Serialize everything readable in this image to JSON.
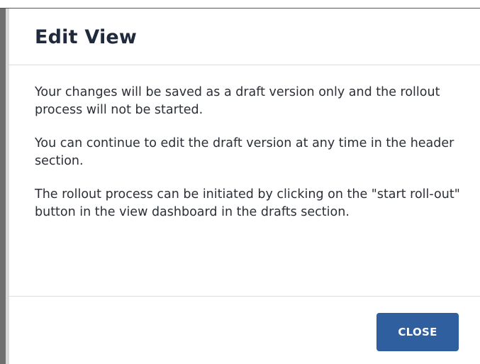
{
  "dialog": {
    "title": "Edit View",
    "paragraphs": [
      "Your changes will be saved as a draft version only and the rollout process will not be started.",
      "You can continue to edit the draft version at any time in the header section.",
      "The rollout process can be initiated by clicking on the \"start roll-out\" button in the view dashboard in the drafts section."
    ],
    "close_label": "CLOSE"
  },
  "colors": {
    "primary_button": "#2f5f9e",
    "title_text": "#1f2a3d",
    "body_text": "#2b2f36",
    "divider": "#dedede"
  }
}
